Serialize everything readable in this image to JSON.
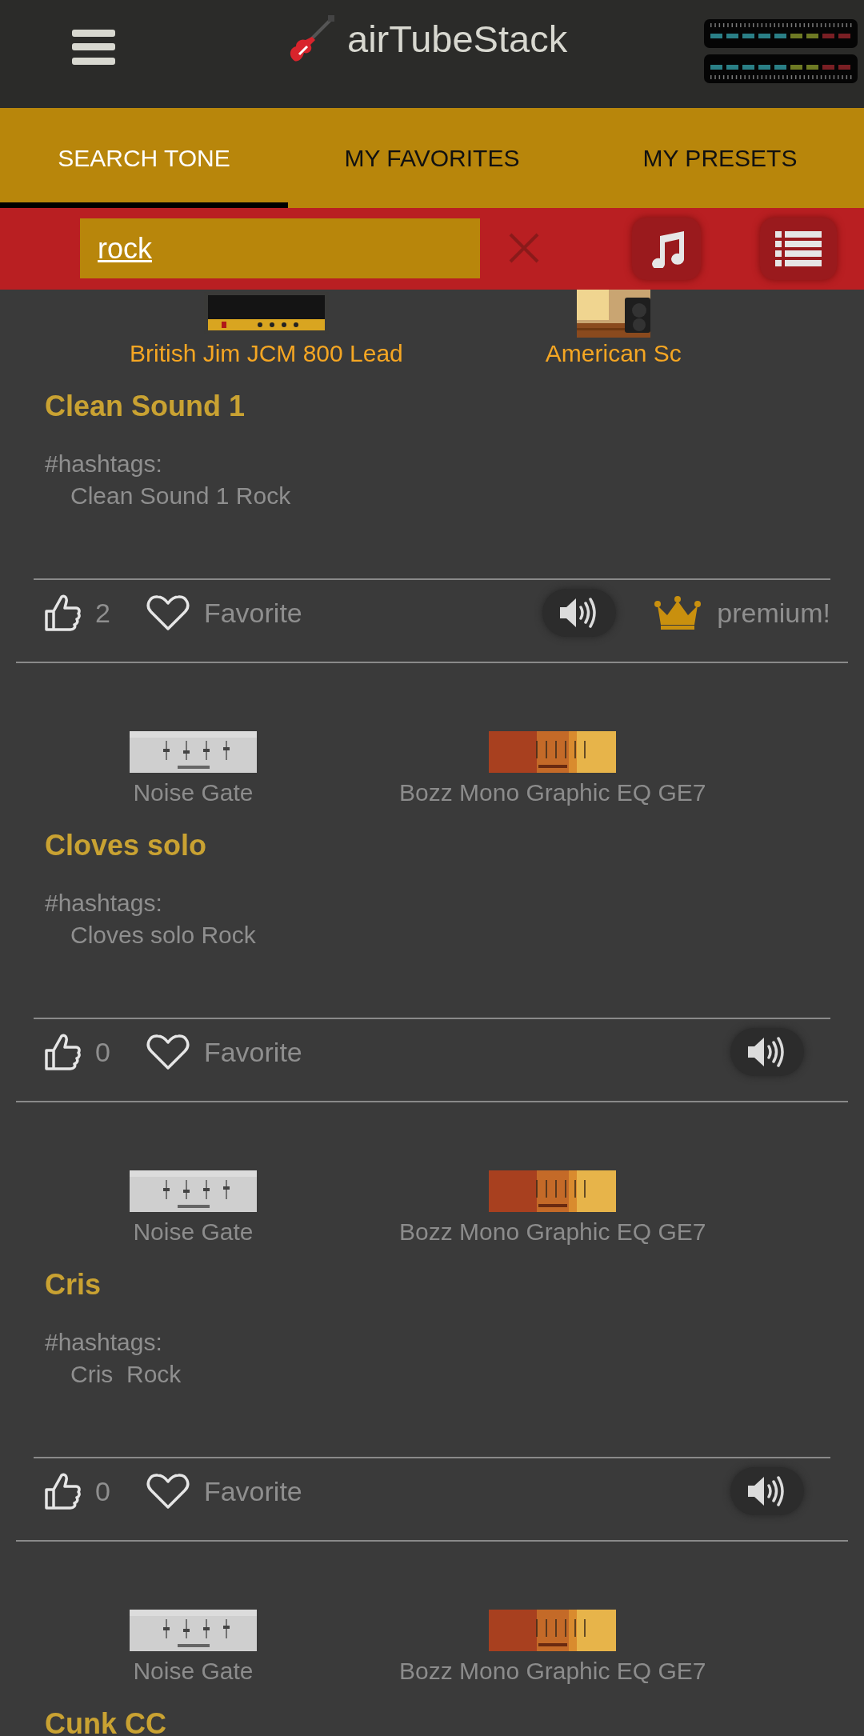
{
  "header": {
    "title": "airTubeStack"
  },
  "tabs": [
    {
      "label": "SEARCH TONE",
      "selected": true
    },
    {
      "label": "MY FAVORITES",
      "selected": false
    },
    {
      "label": "MY PRESETS",
      "selected": false
    }
  ],
  "search": {
    "value": "rock"
  },
  "presets": [
    {
      "devices": [
        {
          "name": "British Jim JCM 800 Lead",
          "kind": "amp"
        },
        {
          "name": "American Sc",
          "kind": "cabinet"
        }
      ],
      "title": "Clean Sound 1",
      "hashtags_label": "#hashtags:",
      "hashtags": "Clean Sound 1 Rock",
      "likes": "2",
      "favorite": false,
      "favorite_label": "Favorite",
      "premium": "premium!"
    },
    {
      "devices": [
        {
          "name": "Noise Gate",
          "kind": "gate"
        },
        {
          "name": "Bozz Mono Graphic EQ GE7",
          "kind": "eq"
        }
      ],
      "title": "Cloves solo",
      "hashtags_label": "#hashtags:",
      "hashtags": "Cloves solo Rock",
      "likes": "0",
      "favorite": false,
      "favorite_label": "Favorite"
    },
    {
      "devices": [
        {
          "name": "Noise Gate",
          "kind": "gate"
        },
        {
          "name": "Bozz Mono Graphic EQ GE7",
          "kind": "eq"
        }
      ],
      "title": "Cris",
      "hashtags_label": "#hashtags:",
      "hashtags": "Cris  Rock",
      "likes": "0",
      "favorite": false,
      "favorite_label": "Favorite"
    },
    {
      "devices": [
        {
          "name": "Noise Gate",
          "kind": "gate"
        },
        {
          "name": "Bozz Mono Graphic EQ GE7",
          "kind": "eq"
        }
      ],
      "title": "Cunk CC"
    }
  ]
}
